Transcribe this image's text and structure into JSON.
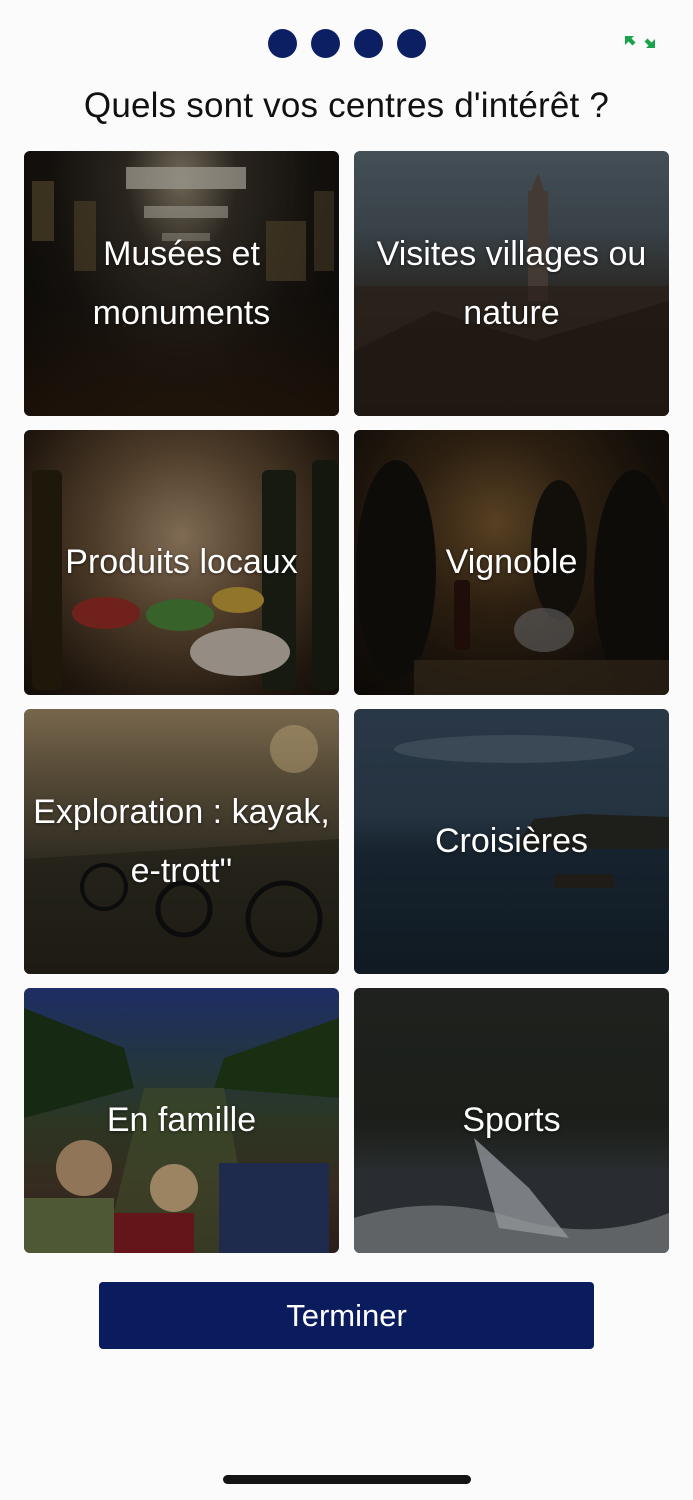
{
  "progress": {
    "total_steps": 4,
    "filled_steps": 4,
    "color": "#0c1f63"
  },
  "header": {
    "expand_icon": "expand-arrows-icon",
    "expand_icon_color": "#1aa34a"
  },
  "title": "Quels sont vos centres d'intérêt ?",
  "interests": [
    {
      "label": "Musées et monuments",
      "icon": "museum-photo"
    },
    {
      "label": "Visites villages ou nature",
      "icon": "village-photo"
    },
    {
      "label": "Produits locaux",
      "icon": "local-products-photo"
    },
    {
      "label": "Vignoble",
      "icon": "vineyard-photo"
    },
    {
      "label": "Exploration : kayak, e-trott''",
      "icon": "exploration-photo"
    },
    {
      "label": "Croisières",
      "icon": "cruise-photo"
    },
    {
      "label": "En famille",
      "icon": "family-photo"
    },
    {
      "label": "Sports",
      "icon": "sports-photo"
    }
  ],
  "finish_button": {
    "label": "Terminer",
    "color": "#0b1c5e"
  }
}
